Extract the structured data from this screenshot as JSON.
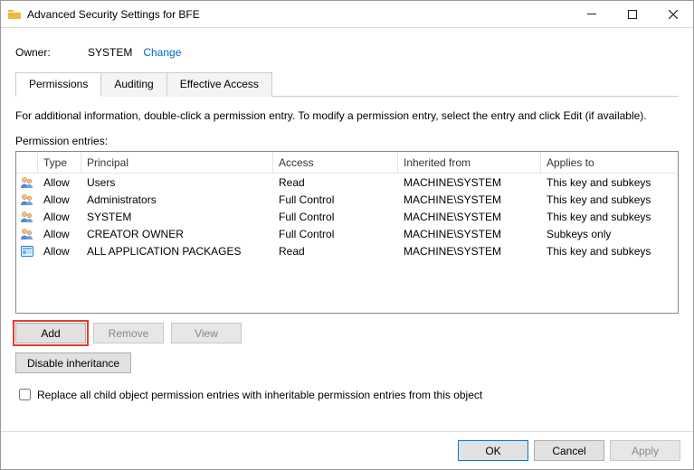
{
  "window": {
    "title": "Advanced Security Settings for BFE"
  },
  "owner": {
    "label": "Owner:",
    "value": "SYSTEM",
    "change": "Change"
  },
  "tabs": {
    "permissions": "Permissions",
    "auditing": "Auditing",
    "effective": "Effective Access"
  },
  "instruction": "For additional information, double-click a permission entry. To modify a permission entry, select the entry and click Edit (if available).",
  "entries_label": "Permission entries:",
  "columns": {
    "type": "Type",
    "principal": "Principal",
    "access": "Access",
    "inherited": "Inherited from",
    "applies": "Applies to"
  },
  "rows": [
    {
      "icon": "group",
      "type": "Allow",
      "principal": "Users",
      "access": "Read",
      "inherited": "MACHINE\\SYSTEM",
      "applies": "This key and subkeys"
    },
    {
      "icon": "group",
      "type": "Allow",
      "principal": "Administrators",
      "access": "Full Control",
      "inherited": "MACHINE\\SYSTEM",
      "applies": "This key and subkeys"
    },
    {
      "icon": "group",
      "type": "Allow",
      "principal": "SYSTEM",
      "access": "Full Control",
      "inherited": "MACHINE\\SYSTEM",
      "applies": "This key and subkeys"
    },
    {
      "icon": "group",
      "type": "Allow",
      "principal": "CREATOR OWNER",
      "access": "Full Control",
      "inherited": "MACHINE\\SYSTEM",
      "applies": "Subkeys only"
    },
    {
      "icon": "package",
      "type": "Allow",
      "principal": "ALL APPLICATION PACKAGES",
      "access": "Read",
      "inherited": "MACHINE\\SYSTEM",
      "applies": "This key and subkeys"
    }
  ],
  "buttons": {
    "add": "Add",
    "remove": "Remove",
    "view": "View",
    "disable_inheritance": "Disable inheritance",
    "ok": "OK",
    "cancel": "Cancel",
    "apply": "Apply"
  },
  "replace_checkbox": "Replace all child object permission entries with inheritable permission entries from this object"
}
